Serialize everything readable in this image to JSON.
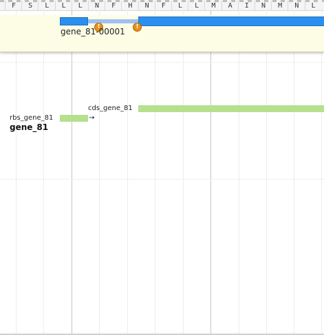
{
  "ruler": {
    "amino_acids": [
      "F",
      "S",
      "L",
      "L",
      "L",
      "N",
      "F",
      "H",
      "N",
      "F",
      "L",
      "L",
      "M",
      "A",
      "I",
      "N",
      "M",
      "N",
      "L"
    ]
  },
  "transcript": {
    "label": "gene_81-00001",
    "exon_color": "#2a8ff0",
    "intron_color": "#9ec1f2",
    "warning_glyph": "!",
    "warning_icon": "warning-icon",
    "highlight_color": "#fdfde6"
  },
  "features": {
    "cds_label": "cds_gene_81",
    "rbs_label": "rbs_gene_81",
    "gene_label": "gene_81",
    "feature_color": "#b5e08e",
    "strand_arrow": "→"
  }
}
